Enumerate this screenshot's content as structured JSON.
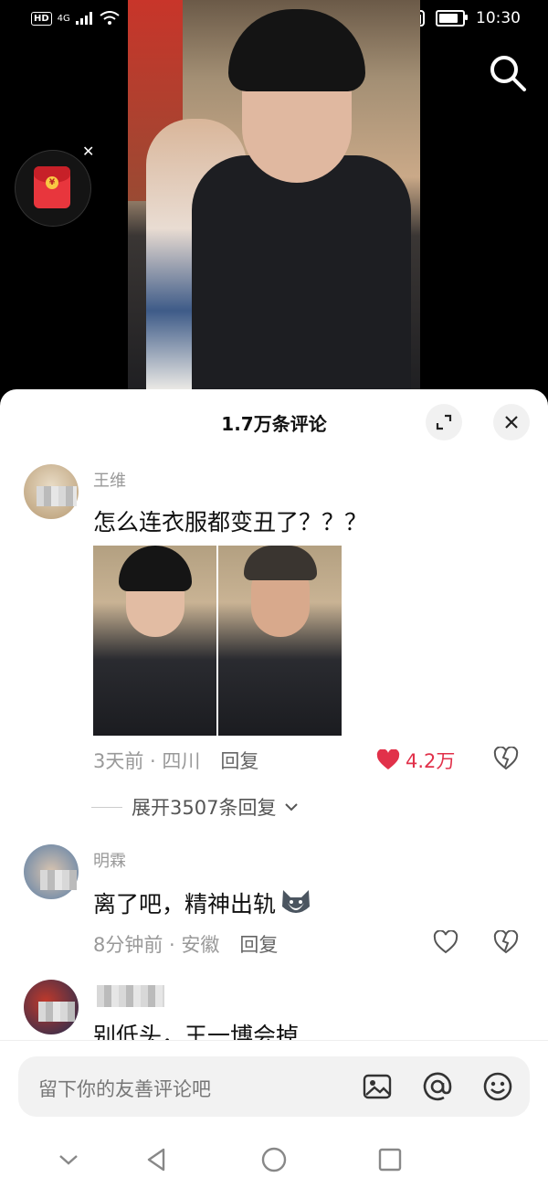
{
  "status_bar": {
    "network": "4G",
    "hd": "HD",
    "time": "10:30",
    "battery_level": 0.85
  },
  "panel": {
    "title": "1.7万条评论"
  },
  "comments": [
    {
      "username": "王维",
      "text": "怎么连衣服都变丑了？？？",
      "time": "3天前",
      "location": "四川",
      "reply_label": "回复",
      "likes": "4.2万",
      "liked": true,
      "expand_label": "展开3507条回复"
    },
    {
      "username": "明霖",
      "text": "离了吧，精神出轨",
      "time": "8分钟前",
      "location": "安徽",
      "reply_label": "回复"
    },
    {
      "username": "",
      "text": "别低头，王一博会掉"
    }
  ],
  "input": {
    "placeholder": "留下你的友善评论吧"
  },
  "colors": {
    "like_red": "#e1314a",
    "panel_bg": "#ffffff",
    "bg": "#000000"
  }
}
